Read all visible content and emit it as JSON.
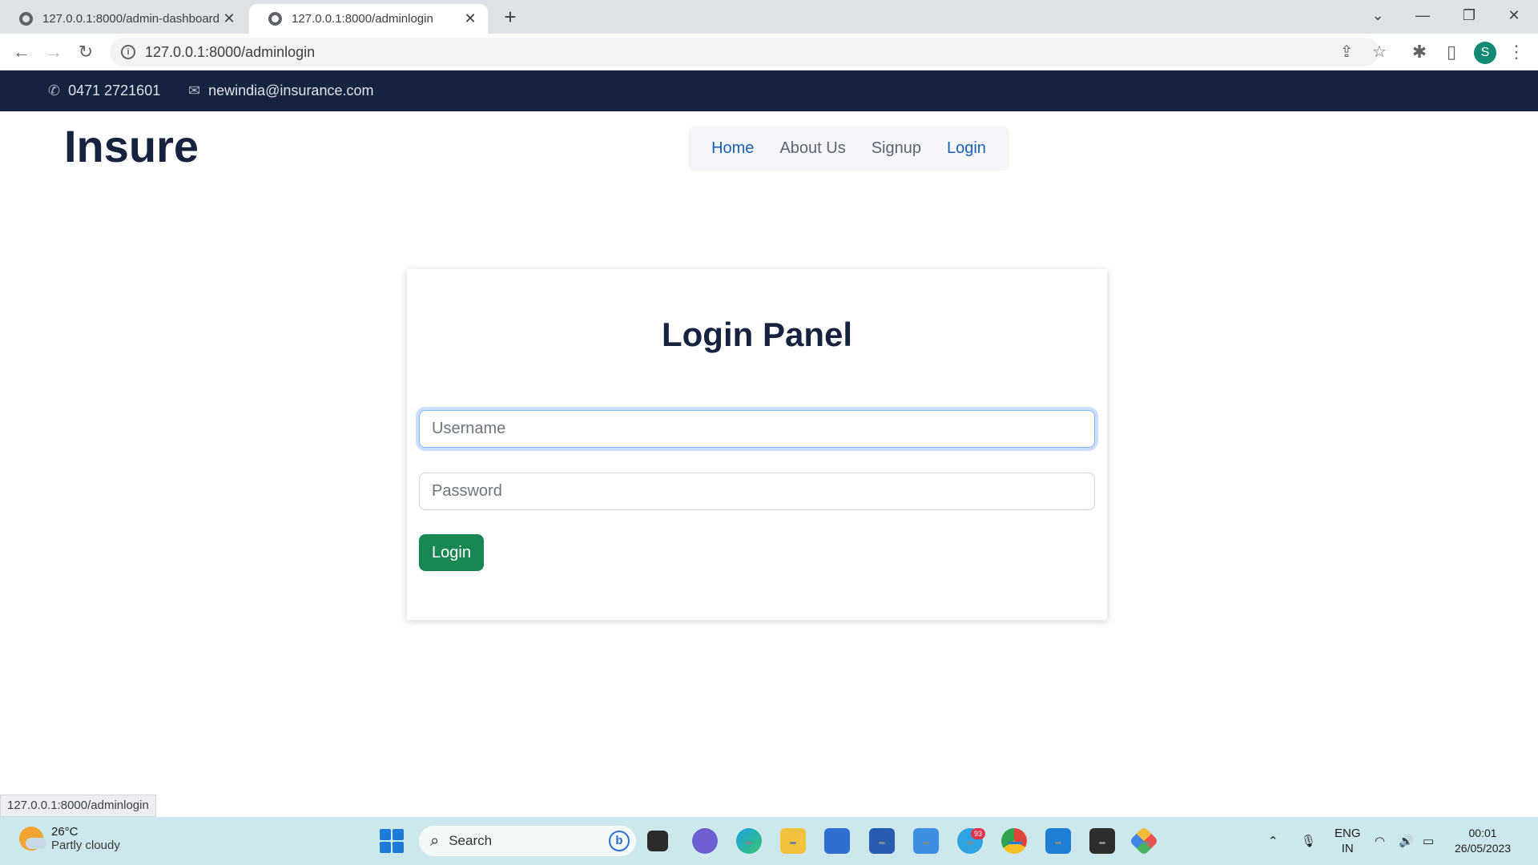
{
  "browser": {
    "tabs": [
      {
        "title": "127.0.0.1:8000/admin-dashboard",
        "active": false
      },
      {
        "title": "127.0.0.1:8000/adminlogin",
        "active": true
      }
    ],
    "new_tab": "+",
    "window_controls": {
      "dropdown": "⌄",
      "minimize": "—",
      "restore": "❐",
      "close": "✕"
    },
    "nav": {
      "back": "←",
      "forward": "→",
      "reload": "↻"
    },
    "url": "127.0.0.1:8000/adminlogin",
    "profile_initial": "S",
    "status_url": "127.0.0.1:8000/adminlogin"
  },
  "topbar": {
    "phone": "0471 2721601",
    "email": "newindia@insurance.com"
  },
  "header": {
    "brand": "Insure",
    "nav": [
      {
        "label": "Home",
        "active": true
      },
      {
        "label": "About Us",
        "active": false
      },
      {
        "label": "Signup",
        "active": false
      },
      {
        "label": "Login",
        "active": true
      }
    ]
  },
  "login_panel": {
    "title": "Login Panel",
    "username_placeholder": "Username",
    "password_placeholder": "Password",
    "button_label": "Login"
  },
  "taskbar": {
    "weather": {
      "temp": "26°C",
      "condition": "Partly cloudy"
    },
    "search_label": "Search",
    "telegram_badge": "93",
    "language": {
      "line1": "ENG",
      "line2": "IN"
    },
    "clock": {
      "time": "00:01",
      "date": "26/05/2023"
    }
  },
  "colors": {
    "topbar_bg": "#15233f",
    "brand": "#15233f",
    "nav_active": "#1a5fb4",
    "login_button": "#198754",
    "taskbar_bg": "#cde8ec"
  }
}
